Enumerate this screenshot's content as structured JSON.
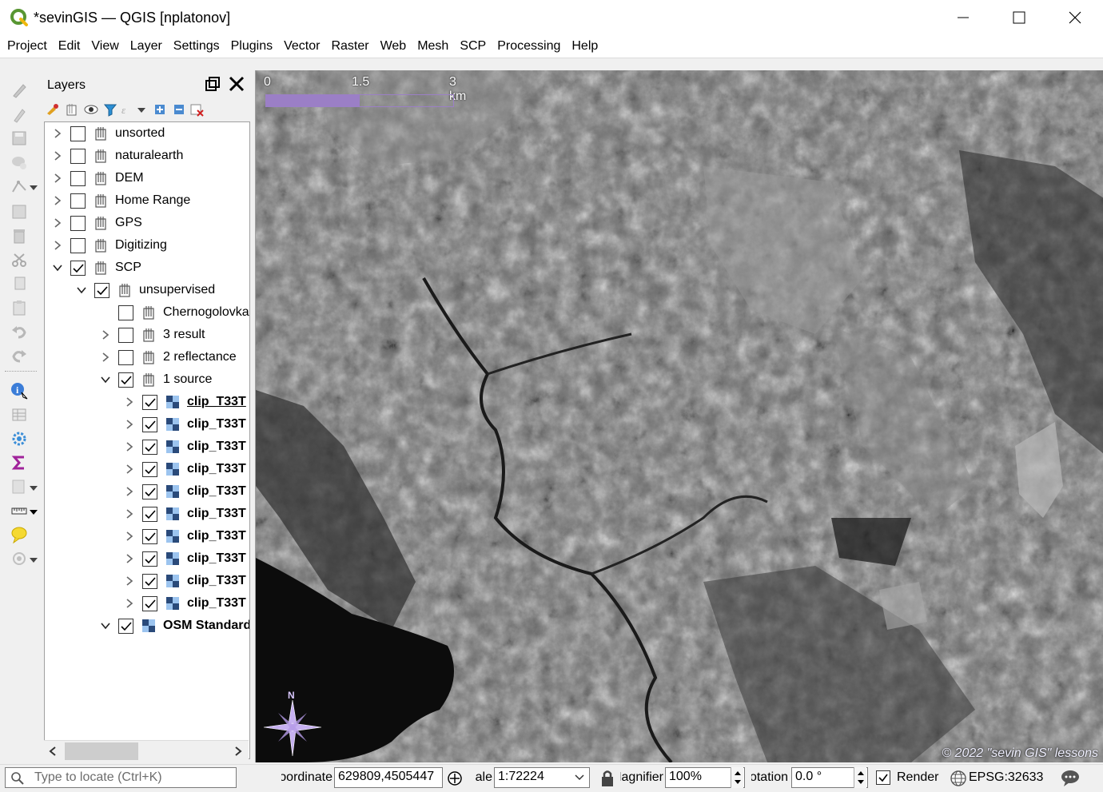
{
  "window": {
    "title": "*sevinGIS — QGIS [nplatonov]"
  },
  "menu": [
    "Project",
    "Edit",
    "View",
    "Layer",
    "Settings",
    "Plugins",
    "Vector",
    "Raster",
    "Web",
    "Mesh",
    "SCP",
    "Processing",
    "Help"
  ],
  "layers_panel": {
    "title": "Layers",
    "tree": [
      {
        "label": "unsorted",
        "checked": false,
        "expanded": false,
        "type": "group"
      },
      {
        "label": "naturalearth",
        "checked": false,
        "expanded": false,
        "type": "group"
      },
      {
        "label": "DEM",
        "checked": false,
        "expanded": false,
        "type": "group"
      },
      {
        "label": "Home Range",
        "checked": false,
        "expanded": false,
        "type": "group"
      },
      {
        "label": "GPS",
        "checked": false,
        "expanded": false,
        "type": "group"
      },
      {
        "label": "Digitizing",
        "checked": false,
        "expanded": false,
        "type": "group"
      },
      {
        "label": "SCP",
        "checked": true,
        "expanded": true,
        "type": "group"
      },
      {
        "label": "unsupervised",
        "checked": true,
        "expanded": true,
        "type": "group"
      },
      {
        "label": "Chernogolovka",
        "checked": false,
        "type": "group"
      },
      {
        "label": "3 result",
        "checked": false,
        "expanded": false,
        "type": "group"
      },
      {
        "label": "2 reflectance",
        "checked": false,
        "expanded": false,
        "type": "group"
      },
      {
        "label": "1 source",
        "checked": true,
        "expanded": true,
        "type": "group"
      },
      {
        "label": "clip_T33T",
        "checked": true,
        "type": "raster"
      },
      {
        "label": "clip_T33T",
        "checked": true,
        "type": "raster"
      },
      {
        "label": "clip_T33T",
        "checked": true,
        "type": "raster"
      },
      {
        "label": "clip_T33T",
        "checked": true,
        "type": "raster"
      },
      {
        "label": "clip_T33T",
        "checked": true,
        "type": "raster"
      },
      {
        "label": "clip_T33T",
        "checked": true,
        "type": "raster"
      },
      {
        "label": "clip_T33T",
        "checked": true,
        "type": "raster"
      },
      {
        "label": "clip_T33T",
        "checked": true,
        "type": "raster"
      },
      {
        "label": "clip_T33T",
        "checked": true,
        "type": "raster"
      },
      {
        "label": "clip_T33T",
        "checked": true,
        "type": "raster"
      },
      {
        "label": "OSM Standard",
        "checked": true,
        "expanded": true,
        "type": "raster"
      }
    ]
  },
  "map": {
    "scalebar": {
      "ticks": [
        "0",
        "1.5",
        "3 km"
      ]
    },
    "north_label": "N",
    "copyright": "© 2022 \"sevin GIS\" lessons"
  },
  "status": {
    "locate_placeholder": "Type to locate (Ctrl+K)",
    "coordinate_label": "Coordinate",
    "coordinate_value": "629809,4505447",
    "scale_label": "Scale",
    "scale_value": "1:72224",
    "magnifier_label": "Magnifier",
    "magnifier_value": "100%",
    "rotation_label": "Rotation",
    "rotation_value": "0.0 °",
    "render_label": "Render",
    "crs_value": "EPSG:32633"
  },
  "colors": {
    "scalebar": "#9b7fc6",
    "qgis_green": "#589632"
  }
}
